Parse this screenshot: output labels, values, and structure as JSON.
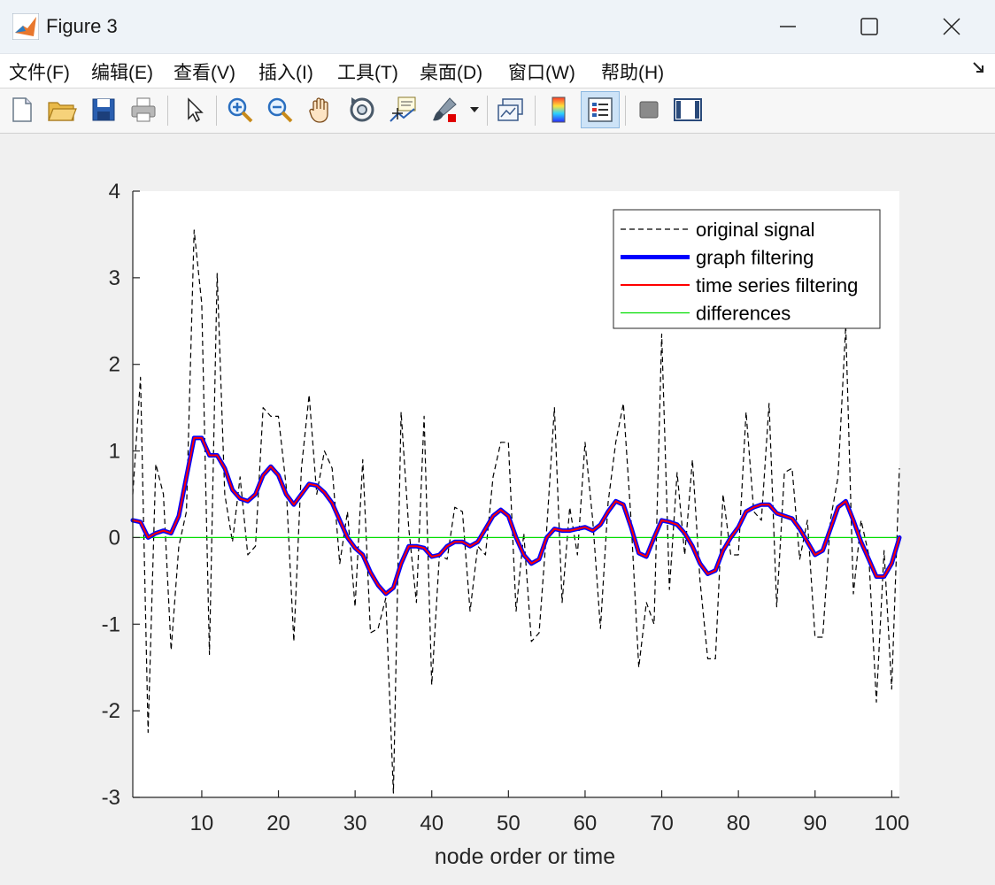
{
  "window": {
    "title": "Figure 3",
    "minimize_icon": "minimize-icon",
    "maximize_icon": "maximize-icon",
    "close_icon": "close-icon"
  },
  "menu": {
    "items": [
      "文件(F)",
      "编辑(E)",
      "查看(V)",
      "插入(I)",
      "工具(T)",
      "桌面(D)",
      "窗口(W)",
      "帮助(H)"
    ]
  },
  "toolbar": {
    "icons": [
      "new-figure-icon",
      "open-file-icon",
      "save-icon",
      "print-icon",
      "pointer-icon",
      "zoom-in-icon",
      "zoom-out-icon",
      "pan-hand-icon",
      "rotate-3d-icon",
      "data-cursor-icon",
      "brush-icon",
      "link-plot-icon",
      "colorbar-icon",
      "legend-icon",
      "hide-plot-tools-icon",
      "show-plot-tools-icon"
    ]
  },
  "chart_data": {
    "type": "line",
    "title": "",
    "xlabel": "node order or time",
    "ylabel": "",
    "xlim": [
      1,
      101
    ],
    "ylim": [
      -3,
      4
    ],
    "xticks": [
      10,
      20,
      30,
      40,
      50,
      60,
      70,
      80,
      90,
      100
    ],
    "xtick_labels": [
      "10",
      "20",
      "30",
      "40",
      "50",
      "60",
      "70",
      "80",
      "90",
      "100"
    ],
    "yticks": [
      -3,
      -2,
      -1,
      0,
      1,
      2,
      3,
      4
    ],
    "ytick_labels": [
      "-3",
      "-2",
      "-1",
      "0",
      "1",
      "2",
      "3",
      "4"
    ],
    "grid": false,
    "legend_position": "top-right",
    "x": [
      1,
      2,
      3,
      4,
      5,
      6,
      7,
      8,
      9,
      10,
      11,
      12,
      13,
      14,
      15,
      16,
      17,
      18,
      19,
      20,
      21,
      22,
      23,
      24,
      25,
      26,
      27,
      28,
      29,
      30,
      31,
      32,
      33,
      34,
      35,
      36,
      37,
      38,
      39,
      40,
      41,
      42,
      43,
      44,
      45,
      46,
      47,
      48,
      49,
      50,
      51,
      52,
      53,
      54,
      55,
      56,
      57,
      58,
      59,
      60,
      61,
      62,
      63,
      64,
      65,
      66,
      67,
      68,
      69,
      70,
      71,
      72,
      73,
      74,
      75,
      76,
      77,
      78,
      79,
      80,
      81,
      82,
      83,
      84,
      85,
      86,
      87,
      88,
      89,
      90,
      91,
      92,
      93,
      94,
      95,
      96,
      97,
      98,
      99,
      100,
      101
    ],
    "series": [
      {
        "name": "original signal",
        "color": "#000000",
        "style": "dashed",
        "width": 1.2,
        "values": [
          0.5,
          1.85,
          -2.25,
          0.85,
          0.5,
          -1.3,
          -0.1,
          0.3,
          3.55,
          2.7,
          -1.35,
          3.05,
          0.5,
          -0.05,
          0.7,
          -0.2,
          -0.1,
          1.5,
          1.4,
          1.4,
          0.6,
          -1.2,
          0.8,
          1.65,
          0.5,
          1.0,
          0.8,
          -0.3,
          0.3,
          -0.8,
          0.9,
          -1.1,
          -1.05,
          -0.7,
          -2.95,
          1.45,
          0.1,
          -0.75,
          1.4,
          -1.7,
          -0.2,
          -0.25,
          0.35,
          0.3,
          -0.85,
          -0.1,
          -0.2,
          0.7,
          1.1,
          1.1,
          -0.85,
          0.05,
          -1.2,
          -1.1,
          0.1,
          1.5,
          -0.75,
          0.35,
          -0.2,
          1.1,
          0.2,
          -1.05,
          0.4,
          1.1,
          1.55,
          0.2,
          -1.5,
          -0.75,
          -1.0,
          2.35,
          -0.6,
          0.75,
          -0.2,
          0.9,
          -0.5,
          -1.4,
          -1.4,
          0.5,
          -0.2,
          -0.2,
          1.45,
          0.3,
          0.2,
          1.55,
          -0.8,
          0.75,
          0.8,
          -0.25,
          0.2,
          -1.15,
          -1.15,
          0.2,
          0.7,
          2.45,
          -0.65,
          0.2,
          -0.2,
          -1.9,
          -0.15,
          -1.75,
          0.8
        ]
      },
      {
        "name": "graph filtering",
        "color": "#0000ff",
        "style": "solid",
        "width": 5,
        "values": [
          0.2,
          0.18,
          0.0,
          0.05,
          0.08,
          0.05,
          0.25,
          0.7,
          1.15,
          1.15,
          0.95,
          0.95,
          0.8,
          0.55,
          0.45,
          0.42,
          0.5,
          0.72,
          0.82,
          0.72,
          0.5,
          0.38,
          0.5,
          0.62,
          0.6,
          0.52,
          0.4,
          0.2,
          0.0,
          -0.12,
          -0.2,
          -0.4,
          -0.55,
          -0.65,
          -0.58,
          -0.3,
          -0.1,
          -0.1,
          -0.12,
          -0.22,
          -0.2,
          -0.1,
          -0.05,
          -0.05,
          -0.1,
          -0.05,
          0.1,
          0.25,
          0.32,
          0.25,
          0.0,
          -0.2,
          -0.3,
          -0.25,
          0.0,
          0.1,
          0.08,
          0.08,
          0.1,
          0.12,
          0.08,
          0.15,
          0.3,
          0.42,
          0.38,
          0.12,
          -0.18,
          -0.22,
          0.0,
          0.2,
          0.18,
          0.15,
          0.05,
          -0.1,
          -0.3,
          -0.42,
          -0.38,
          -0.15,
          0.0,
          0.12,
          0.3,
          0.35,
          0.38,
          0.38,
          0.28,
          0.25,
          0.22,
          0.1,
          -0.05,
          -0.2,
          -0.15,
          0.1,
          0.35,
          0.42,
          0.2,
          -0.05,
          -0.25,
          -0.45,
          -0.45,
          -0.3,
          0.0
        ]
      },
      {
        "name": "time series filtering",
        "color": "#ff0000",
        "style": "solid",
        "width": 2,
        "values": [
          0.2,
          0.18,
          0.0,
          0.05,
          0.08,
          0.05,
          0.25,
          0.7,
          1.15,
          1.15,
          0.95,
          0.95,
          0.8,
          0.55,
          0.45,
          0.42,
          0.5,
          0.72,
          0.82,
          0.72,
          0.5,
          0.38,
          0.5,
          0.62,
          0.6,
          0.52,
          0.4,
          0.2,
          0.0,
          -0.12,
          -0.2,
          -0.4,
          -0.55,
          -0.65,
          -0.58,
          -0.3,
          -0.1,
          -0.1,
          -0.12,
          -0.22,
          -0.2,
          -0.1,
          -0.05,
          -0.05,
          -0.1,
          -0.05,
          0.1,
          0.25,
          0.32,
          0.25,
          0.0,
          -0.2,
          -0.3,
          -0.25,
          0.0,
          0.1,
          0.08,
          0.08,
          0.1,
          0.12,
          0.08,
          0.15,
          0.3,
          0.42,
          0.38,
          0.12,
          -0.18,
          -0.22,
          0.0,
          0.2,
          0.18,
          0.15,
          0.05,
          -0.1,
          -0.3,
          -0.42,
          -0.38,
          -0.15,
          0.0,
          0.12,
          0.3,
          0.35,
          0.38,
          0.38,
          0.28,
          0.25,
          0.22,
          0.1,
          -0.05,
          -0.2,
          -0.15,
          0.1,
          0.35,
          0.42,
          0.2,
          -0.05,
          -0.25,
          -0.45,
          -0.45,
          -0.3,
          0.0
        ]
      },
      {
        "name": "differences",
        "color": "#00dd00",
        "style": "solid",
        "width": 1.2,
        "values": [
          0,
          0,
          0,
          0,
          0,
          0,
          0,
          0,
          0,
          0,
          0,
          0,
          0,
          0,
          0,
          0,
          0,
          0,
          0,
          0,
          0,
          0,
          0,
          0,
          0,
          0,
          0,
          0,
          0,
          0,
          0,
          0,
          0,
          0,
          0,
          0,
          0,
          0,
          0,
          0,
          0,
          0,
          0,
          0,
          0,
          0,
          0,
          0,
          0,
          0,
          0,
          0,
          0,
          0,
          0,
          0,
          0,
          0,
          0,
          0,
          0,
          0,
          0,
          0,
          0,
          0,
          0,
          0,
          0,
          0,
          0,
          0,
          0,
          0,
          0,
          0,
          0,
          0,
          0,
          0,
          0,
          0,
          0,
          0,
          0,
          0,
          0,
          0,
          0,
          0,
          0,
          0,
          0,
          0,
          0,
          0,
          0,
          0,
          0,
          0,
          0
        ]
      }
    ]
  }
}
